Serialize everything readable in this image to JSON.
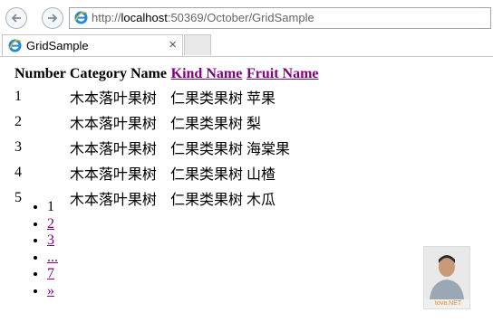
{
  "browser": {
    "url_prefix": "http://",
    "url_host": "localhost",
    "url_rest": ":50369/October/GridSample",
    "tab_title": "GridSample",
    "tab_close": "×"
  },
  "grid": {
    "headers": {
      "number": "Number",
      "category": "Category Name",
      "kind": "Kind Name",
      "fruit": "Fruit Name"
    },
    "rows": [
      {
        "number": "1",
        "category": "木本落叶果树",
        "kind": "仁果类果树",
        "fruit": "苹果"
      },
      {
        "number": "2",
        "category": "木本落叶果树",
        "kind": "仁果类果树",
        "fruit": "梨"
      },
      {
        "number": "3",
        "category": "木本落叶果树",
        "kind": "仁果类果树",
        "fruit": "海棠果"
      },
      {
        "number": "4",
        "category": "木本落叶果树",
        "kind": "仁果类果树",
        "fruit": "山楂"
      },
      {
        "number": "5",
        "category": "木本落叶果树",
        "kind": "仁果类果树",
        "fruit": "木瓜"
      }
    ]
  },
  "pager": {
    "current": "1",
    "links": [
      "2",
      "3",
      "...",
      "7",
      "»"
    ]
  },
  "watermark": "tova.NET"
}
